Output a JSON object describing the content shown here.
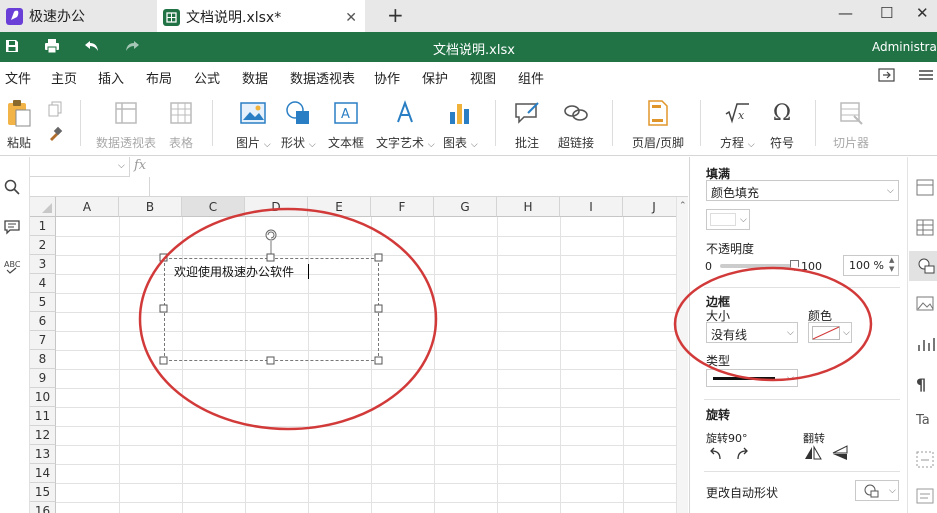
{
  "tabs": [
    {
      "title": "极速办公"
    },
    {
      "title": "文档说明.xlsx*"
    }
  ],
  "window": {
    "minimize": "—",
    "maximize": "☐",
    "close": "✕",
    "new_tab": "+"
  },
  "quickbar": {
    "doc_title": "文档说明.xlsx",
    "user": "Administrator"
  },
  "menu": {
    "items": [
      "文件",
      "主页",
      "插入",
      "布局",
      "公式",
      "数据",
      "数据透视表",
      "协作",
      "保护",
      "视图",
      "组件"
    ],
    "active": "插入"
  },
  "ribbon": {
    "paste": "粘贴",
    "pivot": "数据透视表",
    "table": "表格",
    "picture": "图片",
    "shape": "形状",
    "textbox": "文本框",
    "wordart": "文字艺术",
    "chart": "图表",
    "comment": "批注",
    "hyperlink": "超链接",
    "header_footer": "页眉/页脚",
    "equation": "方程",
    "symbol": "符号",
    "slicer": "切片器"
  },
  "formula_bar": {
    "fx": "fx",
    "name_box": "",
    "content": ""
  },
  "grid": {
    "columns": [
      "A",
      "B",
      "C",
      "D",
      "E",
      "F",
      "G",
      "H",
      "I",
      "J"
    ],
    "selected_column": "C",
    "rows": [
      "1",
      "2",
      "3",
      "4",
      "5",
      "6",
      "7",
      "8",
      "9",
      "10",
      "11",
      "12",
      "13",
      "14",
      "15",
      "16"
    ],
    "textbox_text": "欢迎使用极速办公软件"
  },
  "panel": {
    "fill_title": "填满",
    "fill_type": "颜色填充",
    "opacity_title": "不透明度",
    "opacity_min": "0",
    "opacity_max": "100",
    "opacity_value": "100 %",
    "opacity_level": 1.0,
    "border_title": "边框",
    "size_label": "大小",
    "color_label": "颜色",
    "size_value": "没有线",
    "type_label": "类型",
    "rotation_title": "旋转",
    "rotate90_label": "旋转90°",
    "flip_label": "翻转",
    "change_shape": "更改自动形状"
  },
  "colors": {
    "brand_green": "#217346",
    "annotation_red": "#d23a3a"
  }
}
